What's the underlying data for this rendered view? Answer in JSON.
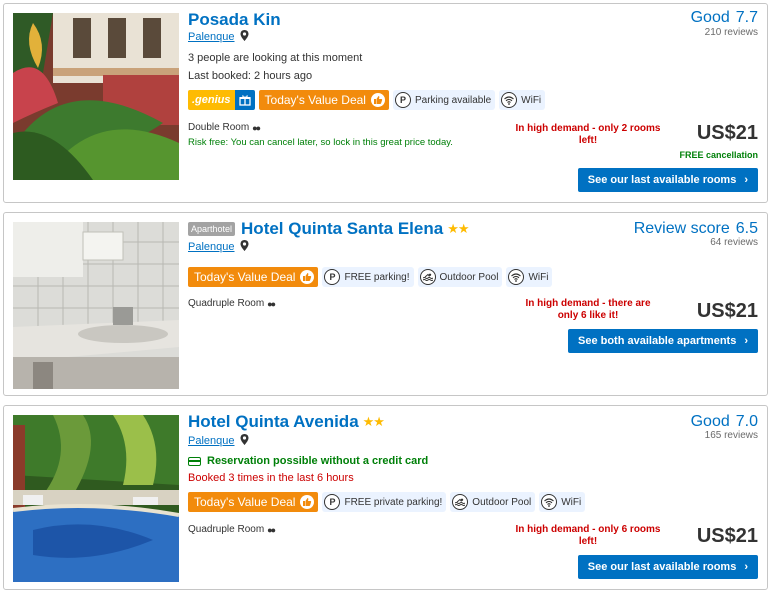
{
  "hotels": [
    {
      "name": "Posada Kin",
      "type_badge": "",
      "stars": "",
      "location": "Palenque",
      "line1": "3 people are looking at this moment",
      "line2": "Last booked: 2 hours ago",
      "genius": ".genius",
      "deal": "Today's Value Deal",
      "facilities": [
        "Parking available",
        "WiFi"
      ],
      "room": "Double Room",
      "risk_free": "Risk free: You can cancel later, so lock in this great price today.",
      "score_word": "Good",
      "score": "7.7",
      "reviews": "210 reviews",
      "demand": "In high demand - only 2 rooms left!",
      "price": "US$21",
      "free_cancellation": "FREE cancellation",
      "cta": "See our last available rooms"
    },
    {
      "name": "Hotel Quinta Santa Elena",
      "type_badge": "Aparthotel",
      "stars": "★★",
      "location": "Palenque",
      "deal": "Today's Value Deal",
      "facilities": [
        "FREE parking!",
        "Outdoor Pool",
        "WiFi"
      ],
      "room": "Quadruple Room",
      "score_word": "Review score",
      "score": "6.5",
      "reviews": "64 reviews",
      "demand": "In high demand - there are only 6 like it!",
      "price": "US$21",
      "cta": "See both available apartments"
    },
    {
      "name": "Hotel Quinta Avenida",
      "type_badge": "",
      "stars": "★★",
      "location": "Palenque",
      "reservation": "Reservation possible without a credit card",
      "booked": "Booked 3 times in the last 6 hours",
      "deal": "Today's Value Deal",
      "facilities": [
        "FREE private parking!",
        "Outdoor Pool",
        "WiFi"
      ],
      "room": "Quadruple Room",
      "score_word": "Good",
      "score": "7.0",
      "reviews": "165 reviews",
      "demand": "In high demand - only 6 rooms left!",
      "price": "US$21",
      "cta": "See our last available rooms"
    }
  ],
  "icons": [
    "location-pin-icon",
    "gift-icon",
    "thumbs-up-icon",
    "parking-icon",
    "wifi-icon",
    "pool-icon",
    "people-icon",
    "credit-card-icon",
    "chevron-right-icon"
  ],
  "colors": {
    "link": "#0071c2",
    "deal": "#f28b0c",
    "genius": "#febb02",
    "green": "#008009",
    "red": "#cc0000",
    "facility_bg": "#ebf3ff"
  }
}
